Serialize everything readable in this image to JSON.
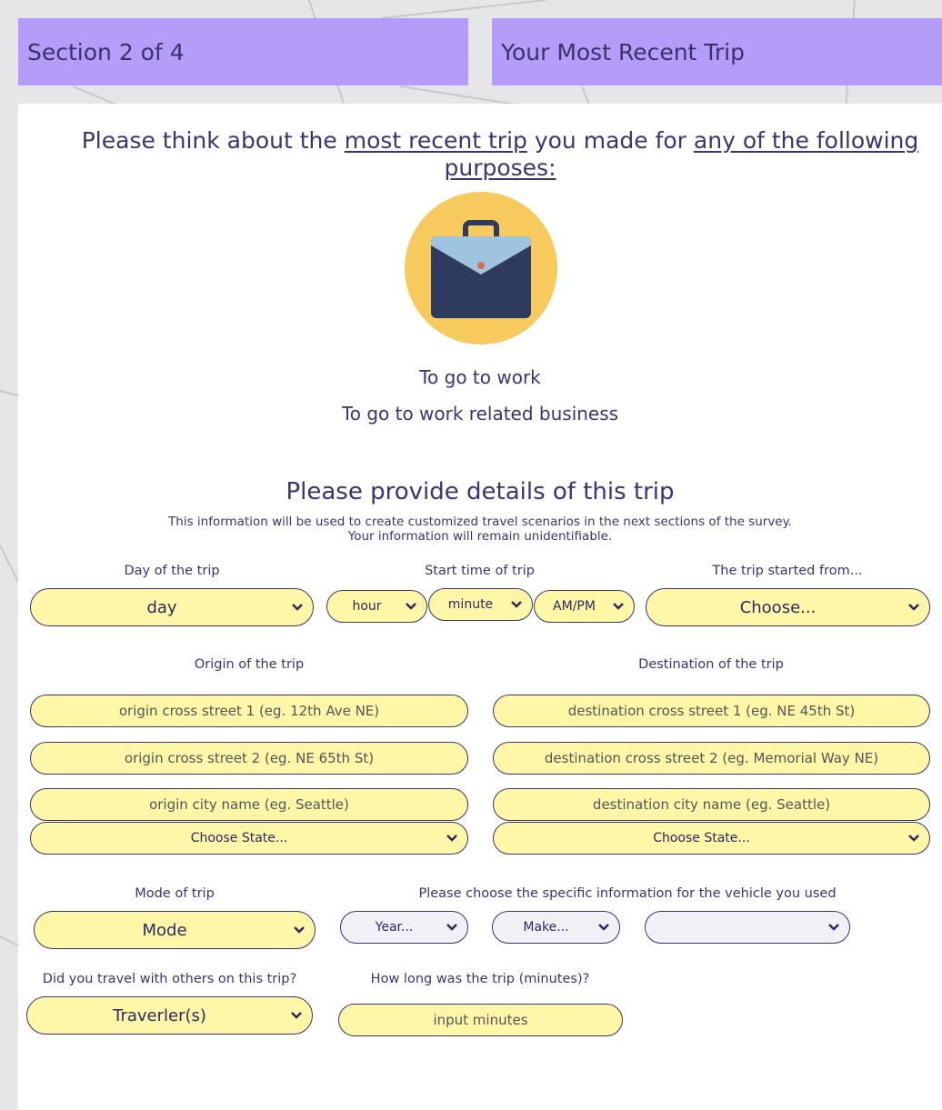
{
  "header": {
    "section": "Section 2 of 4",
    "title": "Your Most Recent Trip"
  },
  "intro": {
    "prefix": "Please think about the ",
    "link1": "most recent trip",
    "middle": " you made for ",
    "link2": "any of the following",
    "link3": "purposes:"
  },
  "purposes": [
    "To go to work",
    "To go to work related business"
  ],
  "details": {
    "title": "Please provide details of this trip",
    "subtitle1": "This information will be used to create customized travel scenarios in the next sections of the survey.",
    "subtitle2": "Your information will remain unidentifiable."
  },
  "labels": {
    "day": "Day of the trip",
    "start_time": "Start time of trip",
    "started_from": "The trip started from...",
    "origin": "Origin of the trip",
    "destination": "Destination of the trip",
    "mode": "Mode of trip",
    "vehicle": "Please choose the specific information for the vehicle you used",
    "others": "Did you travel with others on this trip?",
    "duration": "How long was the trip (minutes)?"
  },
  "selects": {
    "day": "day",
    "hour": "hour",
    "minute": "minute",
    "ampm": "AM/PM",
    "started_from": "Choose...",
    "origin_state": "Choose State...",
    "dest_state": "Choose State...",
    "mode": "Mode",
    "year": "Year...",
    "make": "Make...",
    "model": "",
    "travelers": "Traverler(s)"
  },
  "placeholders": {
    "origin1": "origin cross street 1 (eg. 12th Ave NE)",
    "origin2": "origin cross street 2 (eg. NE 65th St)",
    "origin_city": "origin city name (eg. Seattle)",
    "dest1": "destination cross street 1 (eg. NE 45th St)",
    "dest2": "destination cross street 2 (eg. Memorial Way NE)",
    "dest_city": "destination city name (eg. Seattle)",
    "minutes": "input minutes"
  },
  "icons": {
    "briefcase": "briefcase-icon",
    "chevron": "chevron-down-icon"
  },
  "colors": {
    "banner": "#b59cf9",
    "field": "#fff6a8",
    "text": "#3a3570"
  }
}
